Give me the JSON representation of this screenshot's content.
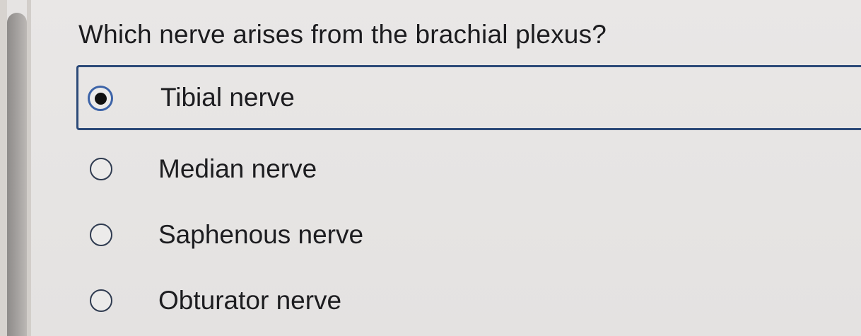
{
  "quiz": {
    "question": "Which nerve arises from the brachial plexus?",
    "selected_index": 0,
    "options": [
      {
        "label": "Tibial nerve"
      },
      {
        "label": "Median nerve"
      },
      {
        "label": "Saphenous nerve"
      },
      {
        "label": "Obturator nerve"
      }
    ]
  },
  "colors": {
    "selection_border": "#2c4a78",
    "radio_selected_ring": "#3d64a8",
    "text": "#1d1d20",
    "background": "#e6e4e3"
  }
}
